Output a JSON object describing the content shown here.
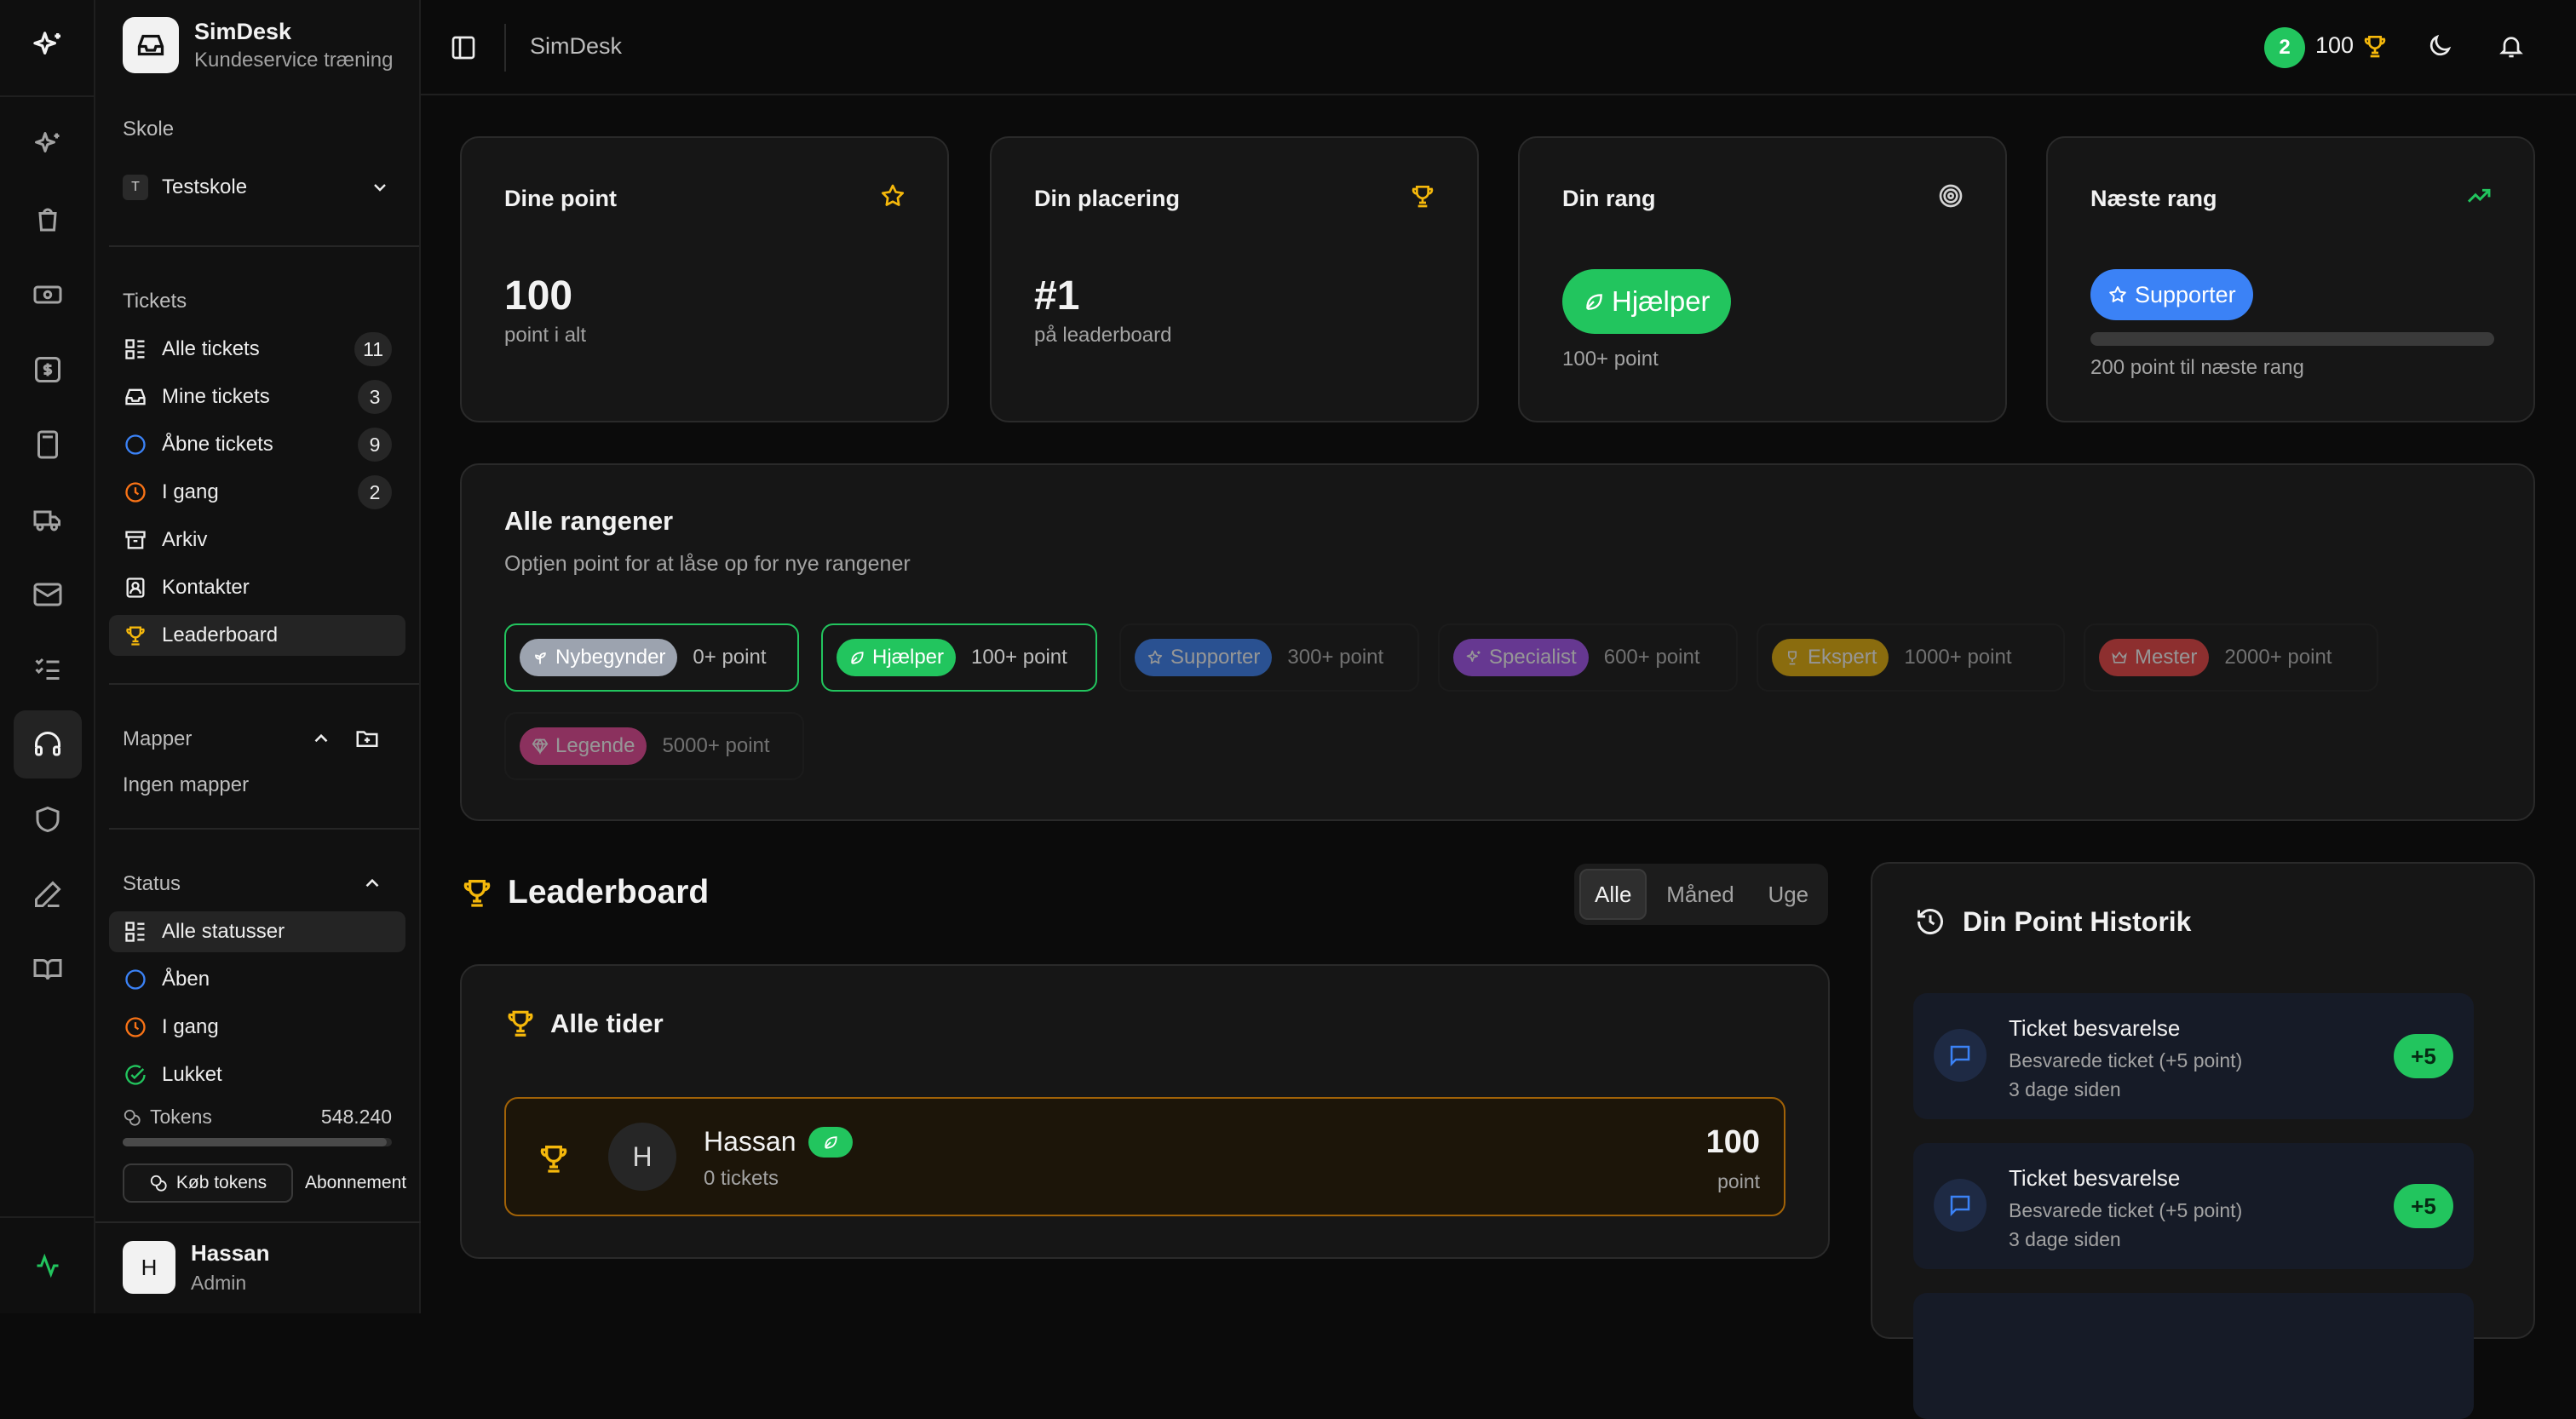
{
  "app": {
    "name": "SimDesk",
    "subtitle": "Kundeservice træning"
  },
  "school": {
    "label": "Skole",
    "avatar_letter": "T",
    "selected": "Testskole"
  },
  "tickets_section": {
    "label": "Tickets",
    "items": [
      {
        "label": "Alle tickets",
        "count": "11"
      },
      {
        "label": "Mine tickets",
        "count": "3"
      },
      {
        "label": "Åbne tickets",
        "count": "9"
      },
      {
        "label": "I gang",
        "count": "2"
      },
      {
        "label": "Arkiv"
      },
      {
        "label": "Kontakter"
      },
      {
        "label": "Leaderboard"
      }
    ]
  },
  "folders": {
    "label": "Mapper",
    "empty": "Ingen mapper"
  },
  "status_section": {
    "label": "Status",
    "items": [
      {
        "label": "Alle statusser"
      },
      {
        "label": "Åben"
      },
      {
        "label": "I gang"
      },
      {
        "label": "Lukket"
      }
    ]
  },
  "tokens": {
    "label": "Tokens",
    "value": "548.240",
    "fill_fraction": 0.98,
    "buy_label": "Køb tokens",
    "subscription_label": "Abonnement"
  },
  "user": {
    "avatar_letter": "H",
    "name": "Hassan",
    "role": "Admin"
  },
  "topbar": {
    "title": "SimDesk",
    "level_badge": "2",
    "points": "100"
  },
  "stats": {
    "points": {
      "title": "Dine point",
      "value": "100",
      "caption": "point i alt"
    },
    "placement": {
      "title": "Din placering",
      "value": "#1",
      "caption": "på leaderboard"
    },
    "rank": {
      "title": "Din rang",
      "rank_name": "Hjælper",
      "caption": "100+ point"
    },
    "next_rank": {
      "title": "Næste rang",
      "rank_name": "Supporter",
      "progress_fraction": 0.0,
      "caption": "200 point til næste rang"
    }
  },
  "ranks": {
    "title": "Alle rangener",
    "subtitle": "Optjen point for at låse op for nye rangener",
    "items": [
      {
        "name": "Nybegynder",
        "points": "0+ point",
        "color": "#a3a3a3",
        "unlocked": true
      },
      {
        "name": "Hjælper",
        "points": "100+ point",
        "color": "#22c55e",
        "unlocked": true
      },
      {
        "name": "Supporter",
        "points": "300+ point",
        "color": "#3b82f6",
        "unlocked": false
      },
      {
        "name": "Specialist",
        "points": "600+ point",
        "color": "#a855f7",
        "unlocked": false
      },
      {
        "name": "Ekspert",
        "points": "1000+ point",
        "color": "#eab308",
        "unlocked": false
      },
      {
        "name": "Mester",
        "points": "2000+ point",
        "color": "#ef4444",
        "unlocked": false
      },
      {
        "name": "Legende",
        "points": "5000+ point",
        "color": "#ec4899",
        "unlocked": false
      }
    ]
  },
  "leaderboard": {
    "title": "Leaderboard",
    "tabs": [
      "Alle",
      "Måned",
      "Uge"
    ],
    "active_tab": "Alle",
    "card_title": "Alle tider",
    "entries": [
      {
        "avatar_letter": "H",
        "name": "Hassan",
        "tickets": "0 tickets",
        "points": "100",
        "points_unit": "point"
      }
    ]
  },
  "history": {
    "title": "Din Point Historik",
    "items": [
      {
        "title": "Ticket besvarelse",
        "desc": "Besvarede ticket (+5 point)",
        "time": "3 dage siden",
        "delta": "+5"
      },
      {
        "title": "Ticket besvarelse",
        "desc": "Besvarede ticket (+5 point)",
        "time": "3 dage siden",
        "delta": "+5"
      }
    ]
  },
  "colors": {
    "accent_green": "#22c55e",
    "gold": "#f5b80b",
    "blue": "#3b82f6",
    "orange": "#f97316"
  }
}
